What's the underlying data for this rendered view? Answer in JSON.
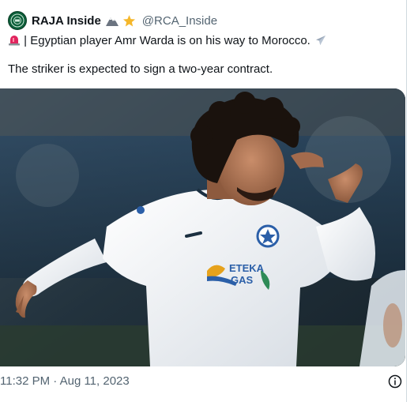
{
  "tweet": {
    "display_name": "RAJA Inside",
    "handle": "@RCA_Inside",
    "name_emojis": [
      "mountain-emoji",
      "star-emoji"
    ],
    "line1": "| Egyptian player Amr Warda is on his way to Morocco.",
    "line1_leading_icon": "siren-icon",
    "line1_trailing_icon": "airplane-icon",
    "line2": "The striker is expected to sign a two-year contract.",
    "media": {
      "description": "Football player in white kit celebrating",
      "shirt_sponsor_top": "ETEKA",
      "shirt_sponsor_bottom": "GAS"
    },
    "timestamp": "11:32 PM · Aug 11, 2023",
    "info_icon": "info-icon"
  },
  "colors": {
    "text": "#0f1419",
    "muted": "#536471",
    "avatar": "#0d5f3a",
    "star": "#f5b72b"
  }
}
